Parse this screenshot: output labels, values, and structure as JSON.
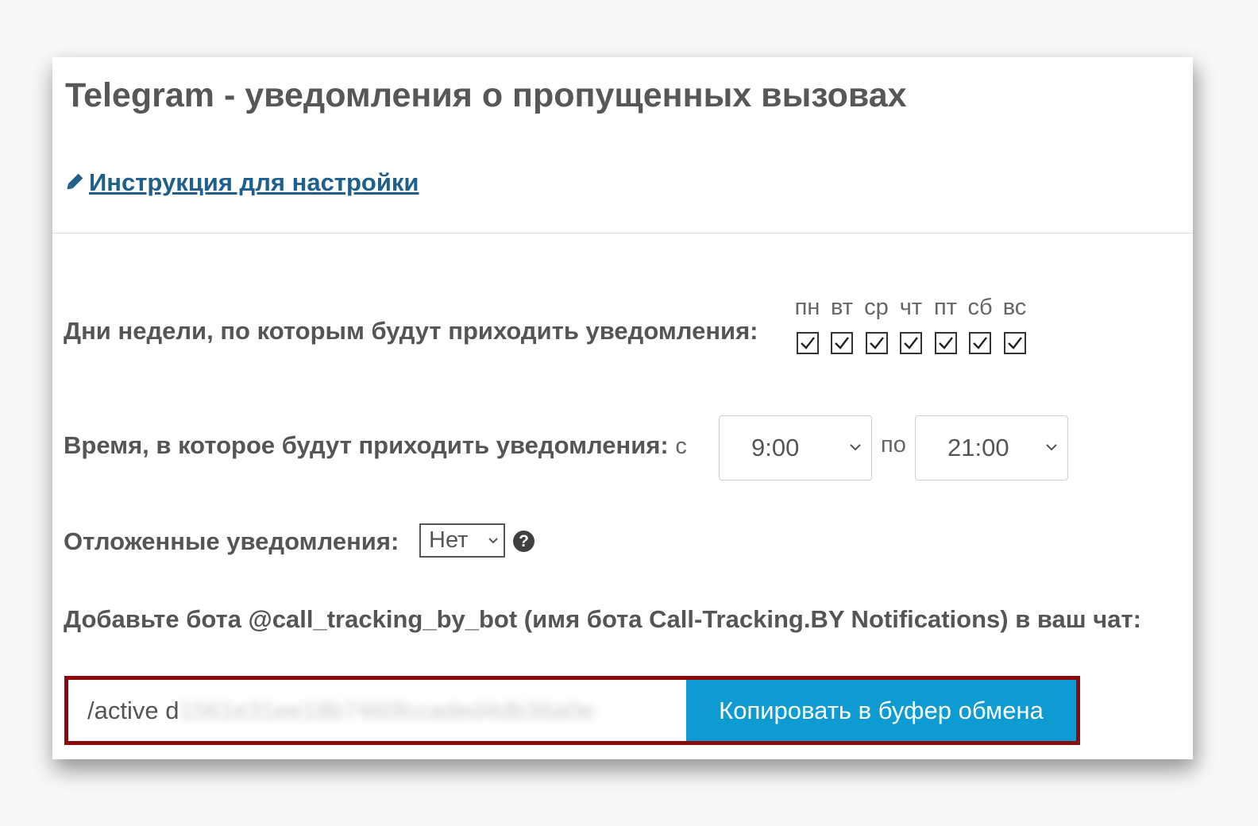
{
  "header": {
    "title": "Telegram - уведомления о пропущенных вызовах",
    "instruction_link": "Инструкция для настройки"
  },
  "weekdays": {
    "label": "Дни недели, по которым будут приходить уведомления:",
    "days": [
      {
        "label": "пн",
        "checked": true
      },
      {
        "label": "вт",
        "checked": true
      },
      {
        "label": "ср",
        "checked": true
      },
      {
        "label": "чт",
        "checked": true
      },
      {
        "label": "пт",
        "checked": true
      },
      {
        "label": "сб",
        "checked": true
      },
      {
        "label": "вс",
        "checked": true
      }
    ]
  },
  "time": {
    "label": "Время, в которое будут приходить уведомления:",
    "from_label": "с",
    "from_value": "9:00",
    "to_label": "по",
    "to_value": "21:00"
  },
  "delayed": {
    "label": "Отложенные уведомления:",
    "value": "Нет",
    "help_icon": "question-circle-icon"
  },
  "bot": {
    "instruction": "Добавьте бота @call_tracking_by_bot (имя бота Call-Tracking.BY Notifications) в ваш чат:",
    "command_visible": "/active d",
    "command_hidden": "1561e31ee18b7460fccaded4db36a0e",
    "copy_button": "Копировать в буфер обмена"
  },
  "colors": {
    "accent": "#0e9bd2",
    "link": "#1f5f8b",
    "highlight_border": "#8b0a0a"
  }
}
